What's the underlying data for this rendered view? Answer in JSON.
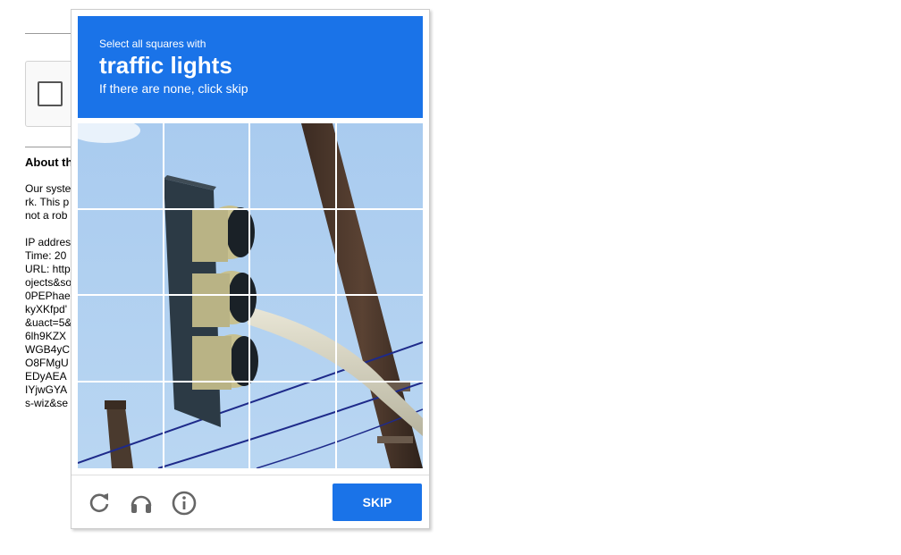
{
  "about": {
    "title": "About th",
    "lines1": [
      "Our syste",
      "rk. This p",
      "not a rob"
    ],
    "lines2": [
      "IP addres",
      "Time: 20",
      "URL: http",
      "ojects&so",
      "0PEPhae",
      "kyXKfpd'",
      "&uact=5&",
      "6lh9KZX",
      "WGB4yC",
      "O8FMgU",
      "EDyAEA",
      "IYjwGYA",
      "s-wiz&se"
    ]
  },
  "challenge": {
    "instruction": "Select all squares with",
    "target": "traffic lights",
    "hint": "If there are none, click skip",
    "skip_label": "SKIP",
    "accent_color": "#1a73e8",
    "grid_size": 4
  },
  "footer": {
    "icons": [
      "reload-icon",
      "audio-headphones-icon",
      "info-icon"
    ]
  }
}
